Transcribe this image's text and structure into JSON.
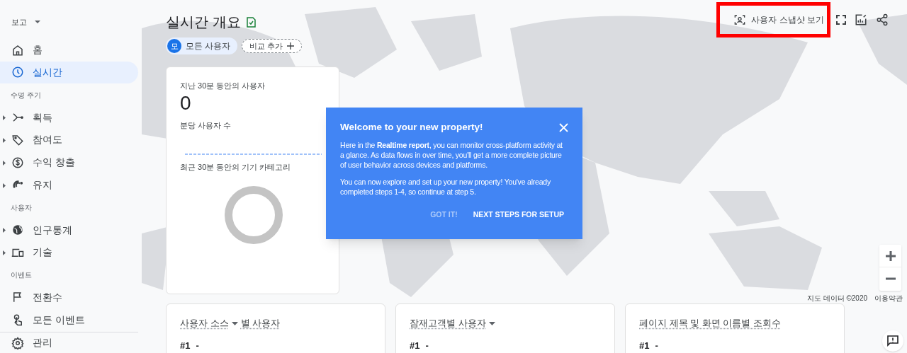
{
  "sidebar": {
    "header": "보고",
    "items": [
      {
        "kind": "item",
        "label": "홈",
        "expandable": false,
        "selected": false
      },
      {
        "kind": "item",
        "label": "실시간",
        "expandable": false,
        "selected": true
      },
      {
        "kind": "section",
        "label": "수명 주기"
      },
      {
        "kind": "item",
        "label": "획득",
        "expandable": true,
        "selected": false
      },
      {
        "kind": "item",
        "label": "참여도",
        "expandable": true,
        "selected": false
      },
      {
        "kind": "item",
        "label": "수익 창출",
        "expandable": true,
        "selected": false
      },
      {
        "kind": "item",
        "label": "유지",
        "expandable": true,
        "selected": false
      },
      {
        "kind": "section",
        "label": "사용자"
      },
      {
        "kind": "item",
        "label": "인구통계",
        "expandable": true,
        "selected": false
      },
      {
        "kind": "item",
        "label": "기술",
        "expandable": true,
        "selected": false
      },
      {
        "kind": "section",
        "label": "이벤트"
      },
      {
        "kind": "item",
        "label": "전환수",
        "expandable": false,
        "selected": false
      },
      {
        "kind": "item",
        "label": "모든 이벤트",
        "expandable": false,
        "selected": false
      }
    ],
    "footer": {
      "label": "관리"
    }
  },
  "header": {
    "title": "실시간 개요",
    "chips": [
      {
        "kind": "segment",
        "avatar": "모",
        "label": "모든 사용자"
      },
      {
        "kind": "add",
        "label": "비교 추가"
      }
    ]
  },
  "toolbar": {
    "snapshot_button": "사용자 스냅샷 보기",
    "highlighted": true
  },
  "users_card": {
    "users_label": "지난 30분 동안의 사용자",
    "users_value": "0",
    "per_minute_label": "분당 사용자 수",
    "device_label": "최근 30분 동안의 기기 카테고리"
  },
  "dialog": {
    "title": "Welcome to your new property!",
    "paragraphs": [
      "Here in the **Realtime report**, you can monitor cross-platform activity at a glance. As data flows in over time, you'll get a more complete picture of user behavior across devices and platforms.",
      "You can now explore and set up your new property! You've already completed steps 1-4, so continue at step 5."
    ],
    "buttons": [
      {
        "kind": "secondary",
        "label": "GOT IT!"
      },
      {
        "kind": "primary",
        "label": "NEXT STEPS FOR SETUP"
      }
    ]
  },
  "map": {
    "kind": "picture",
    "attribution": "지도 데이터 ©2020",
    "terms": "이용약관"
  },
  "bottom_cards": [
    {
      "title": "사용자 소스",
      "has_dropdown": true,
      "suffix": "별 사용자",
      "rank": "#1",
      "value": "-"
    },
    {
      "title": "잠재고객별 사용자",
      "has_dropdown": true,
      "rank": "#1",
      "value": "-"
    },
    {
      "title": "페이지 제목 및 화면 이름별 조회수",
      "has_dropdown": false,
      "rank": "#1",
      "value": "-"
    }
  ]
}
